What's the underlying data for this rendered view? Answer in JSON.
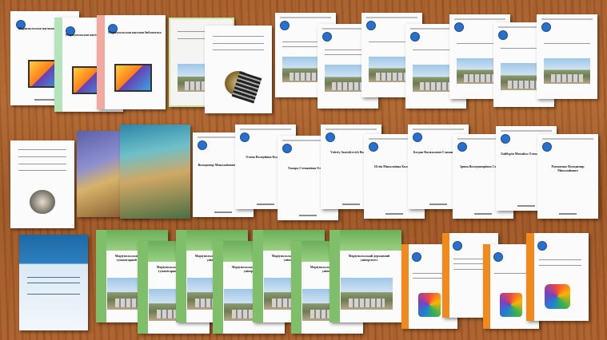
{
  "scene": {
    "description_free": true,
    "background_color": "#a65d2a",
    "documents": [
      {
        "name": "doc-monitor-1",
        "style": "white",
        "title": "Мариупольская научная библиотека"
      },
      {
        "name": "doc-monitor-2",
        "style": "mint",
        "title": "Мариупольская научная библиотека"
      },
      {
        "name": "doc-monitor-3",
        "style": "pink",
        "title": "Мариупольская научная библиотека"
      },
      {
        "name": "doc-building-1",
        "style": "white",
        "title": ""
      },
      {
        "name": "doc-medal",
        "style": "white",
        "title": ""
      },
      {
        "name": "doc-biblio-1",
        "style": "white",
        "title": ""
      },
      {
        "name": "doc-biblio-2",
        "style": "white",
        "title": ""
      },
      {
        "name": "doc-biblio-3",
        "style": "white",
        "title": ""
      },
      {
        "name": "doc-biblio-4",
        "style": "white",
        "title": ""
      },
      {
        "name": "doc-biblio-5",
        "style": "white",
        "title": ""
      },
      {
        "name": "doc-biblio-6",
        "style": "white",
        "title": ""
      },
      {
        "name": "doc-biblio-7",
        "style": "white",
        "title": ""
      },
      {
        "name": "doc-seal",
        "style": "white",
        "title": ""
      },
      {
        "name": "doc-cover-purple",
        "style": "cover",
        "title": ""
      },
      {
        "name": "doc-cover-teal",
        "style": "cover2",
        "title": ""
      },
      {
        "name": "doc-person-1",
        "style": "white",
        "title": "Володимир Миколайович Романов"
      },
      {
        "name": "doc-person-2",
        "style": "white",
        "title": "Олена Валеріївна Кулагіна"
      },
      {
        "name": "doc-person-3",
        "style": "white",
        "title": "Тамара Степанівна Оленич"
      },
      {
        "name": "doc-person-4",
        "style": "white",
        "title": "Valeriy Anatolyevich Buchilov"
      },
      {
        "name": "doc-person-5",
        "style": "white",
        "title": "Юлія Миколаївна Калевич"
      },
      {
        "name": "doc-person-6",
        "style": "white",
        "title": "Богдан Васильович Слишинський"
      },
      {
        "name": "doc-person-7",
        "style": "white",
        "title": "Ірина Володимирівна Самолюк"
      },
      {
        "name": "doc-person-8",
        "style": "white",
        "title": "Байбурін Михайло Олександрович"
      },
      {
        "name": "doc-person-9",
        "style": "white",
        "title": "Романенко Володимир Миколайович"
      },
      {
        "name": "doc-bluebook",
        "style": "bluebook",
        "title": ""
      },
      {
        "name": "doc-green-1",
        "style": "green",
        "title": "Маріупольський державний гуманітарний університет"
      },
      {
        "name": "doc-green-2",
        "style": "green",
        "title": "Маріупольський державний гуманітарний університет"
      },
      {
        "name": "doc-green-3",
        "style": "green",
        "title": "Маріупольський державний університет"
      },
      {
        "name": "doc-green-4",
        "style": "green",
        "title": "Маріупольський державний університет"
      },
      {
        "name": "doc-green-5",
        "style": "green",
        "title": "Маріупольський державний університет"
      },
      {
        "name": "doc-green-6",
        "style": "green",
        "title": "Маріупольський державний університет"
      },
      {
        "name": "doc-green-7",
        "style": "green",
        "title": "Маріупольський державний університет"
      },
      {
        "name": "doc-green-8",
        "style": "green",
        "title": "Маріупольський державний університет"
      },
      {
        "name": "doc-orange-1",
        "style": "orange",
        "title": ""
      },
      {
        "name": "doc-orange-2",
        "style": "orange",
        "title": ""
      },
      {
        "name": "doc-orange-3",
        "style": "orange",
        "title": ""
      },
      {
        "name": "doc-orange-4",
        "style": "orange",
        "title": ""
      },
      {
        "name": "doc-orange-5",
        "style": "orange",
        "title": ""
      }
    ]
  }
}
